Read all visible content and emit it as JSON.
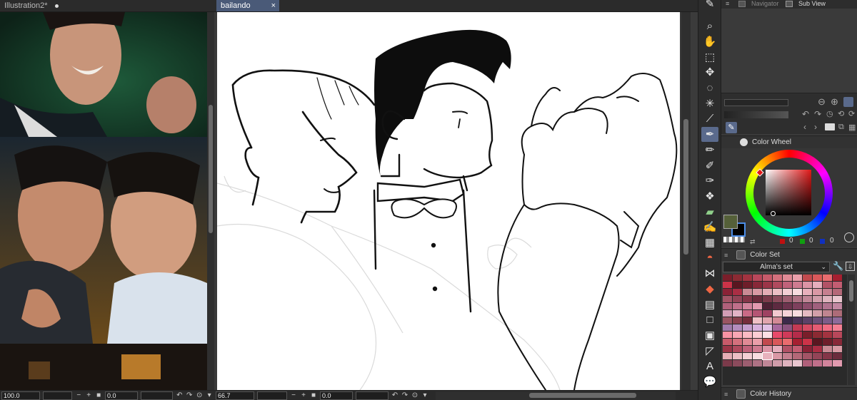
{
  "left_doc": {
    "tab_label": "Illustration2*",
    "zoom": "100.0",
    "angle": "0.0"
  },
  "main_doc": {
    "tab_label": "bailando",
    "zoom": "66.7",
    "angle": "0.0"
  },
  "panels": {
    "navigator_tab": "Navigator",
    "subview_tab": "Sub View",
    "color_wheel_title": "Color Wheel",
    "color_set_title": "Color Set",
    "color_set_name": "Alma's set",
    "color_history_title": "Color History"
  },
  "rgb_readout": {
    "r": "0",
    "g": "0",
    "b": "0"
  },
  "colors": {
    "accent": "#5a6a8c",
    "main_color": "#556039",
    "sub_color": "#000000",
    "wheel_picker": "#b9282d"
  },
  "tools": [
    "pen-edge-icon",
    "zoom-icon",
    "hand-icon",
    "object-icon",
    "move-icon",
    "lasso-icon",
    "magic-wand-icon",
    "eyedropper-icon",
    "pen-icon",
    "pencil-icon",
    "brush-icon",
    "airbrush-icon",
    "decoration-icon",
    "eraser-icon",
    "blend-icon",
    "pattern-icon",
    "cake-icon",
    "bow-icon",
    "fill-icon",
    "gradient-icon",
    "figure-icon",
    "frame-icon",
    "ruler-icon",
    "text-icon",
    "balloon-icon"
  ]
}
